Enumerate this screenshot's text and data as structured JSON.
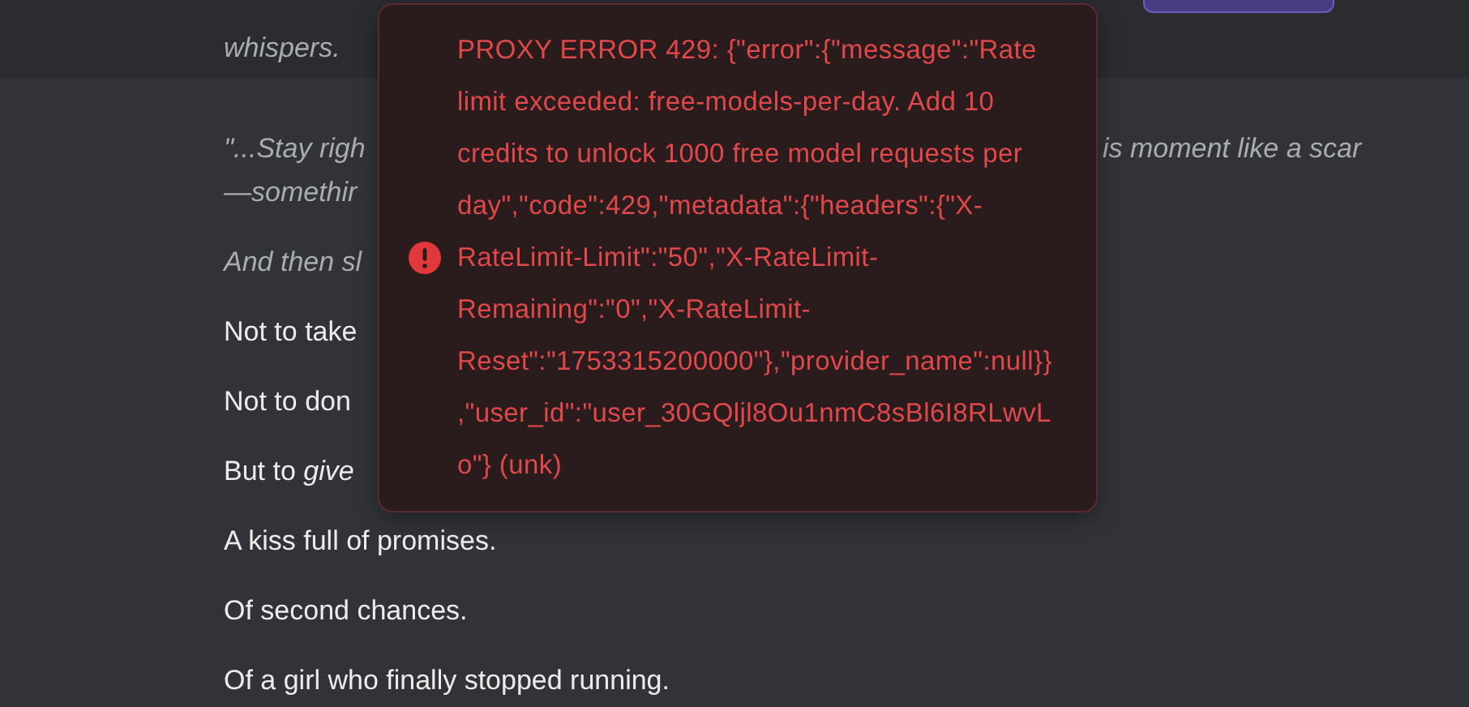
{
  "header": {
    "text": "whispers."
  },
  "paragraphs": [
    {
      "italic": true,
      "lines": [
        {
          "kind": "covered",
          "left": "\"...Stay righ",
          "right": "is moment like a scar"
        },
        {
          "kind": "covered",
          "left": "—somethir"
        }
      ]
    },
    {
      "italic": true,
      "lines": [
        {
          "kind": "covered",
          "left": "And then sl"
        }
      ]
    },
    {
      "italic": false,
      "lines": [
        {
          "kind": "covered",
          "left": "Not to take"
        }
      ]
    },
    {
      "italic": false,
      "lines": [
        {
          "kind": "covered",
          "left": "Not to don"
        }
      ]
    },
    {
      "italic": false,
      "lines": [
        {
          "kind": "covered",
          "left": "But to *give*"
        }
      ]
    },
    {
      "italic": false,
      "lines": [
        {
          "kind": "full",
          "left": "A kiss full of promises."
        }
      ]
    },
    {
      "italic": false,
      "lines": [
        {
          "kind": "full",
          "left": "Of second chances."
        }
      ]
    },
    {
      "italic": false,
      "lines": [
        {
          "kind": "full",
          "left": "Of a girl who finally stopped running."
        }
      ]
    }
  ],
  "error_toast": {
    "message": "PROXY ERROR 429: {\"error\":{\"message\":\"Rate limit exceeded: free-models-per-day. Add 10 credits to unlock 1000 free model requests per day\",\"code\":429,\"metadata\":{\"headers\":{\"X-RateLimit-Limit\":\"50\",\"X-RateLimit-Remaining\":\"0\",\"X-RateLimit-Reset\":\"1753315200000\"},\"provider_name\":null}},\"user_id\":\"user_30GQljl8Ou1nmC8sBl6I8RLwvLo\"} (unk)"
  }
}
